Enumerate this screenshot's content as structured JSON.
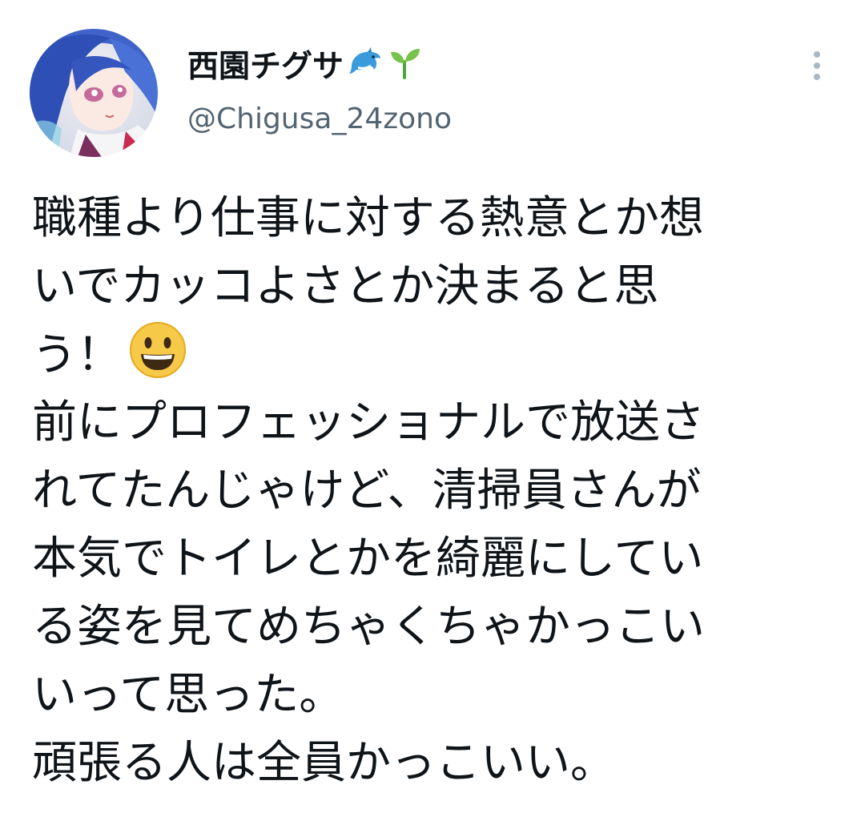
{
  "user": {
    "display_name": "西園チグサ",
    "handle": "@Chigusa_24zono",
    "name_emojis": [
      "dolphin-icon",
      "seedling-icon"
    ]
  },
  "tweet": {
    "lines": [
      "職種より仕事に対する熱意とか想",
      "いでカッコよさとか決まると思",
      "う！",
      "前にプロフェッショナルで放送さ",
      "れてたんじゃけど、清掃員さんが",
      "本気でトイレとかを綺麗にしてい",
      "る姿を見てめちゃくちゃかっこい",
      "いって思った。",
      "頑張る人は全員かっこいい。"
    ],
    "inline_emoji": "grinning-face-icon"
  },
  "colors": {
    "text": "#0f1419",
    "secondary": "#536471",
    "dots": "#aab8c2"
  }
}
